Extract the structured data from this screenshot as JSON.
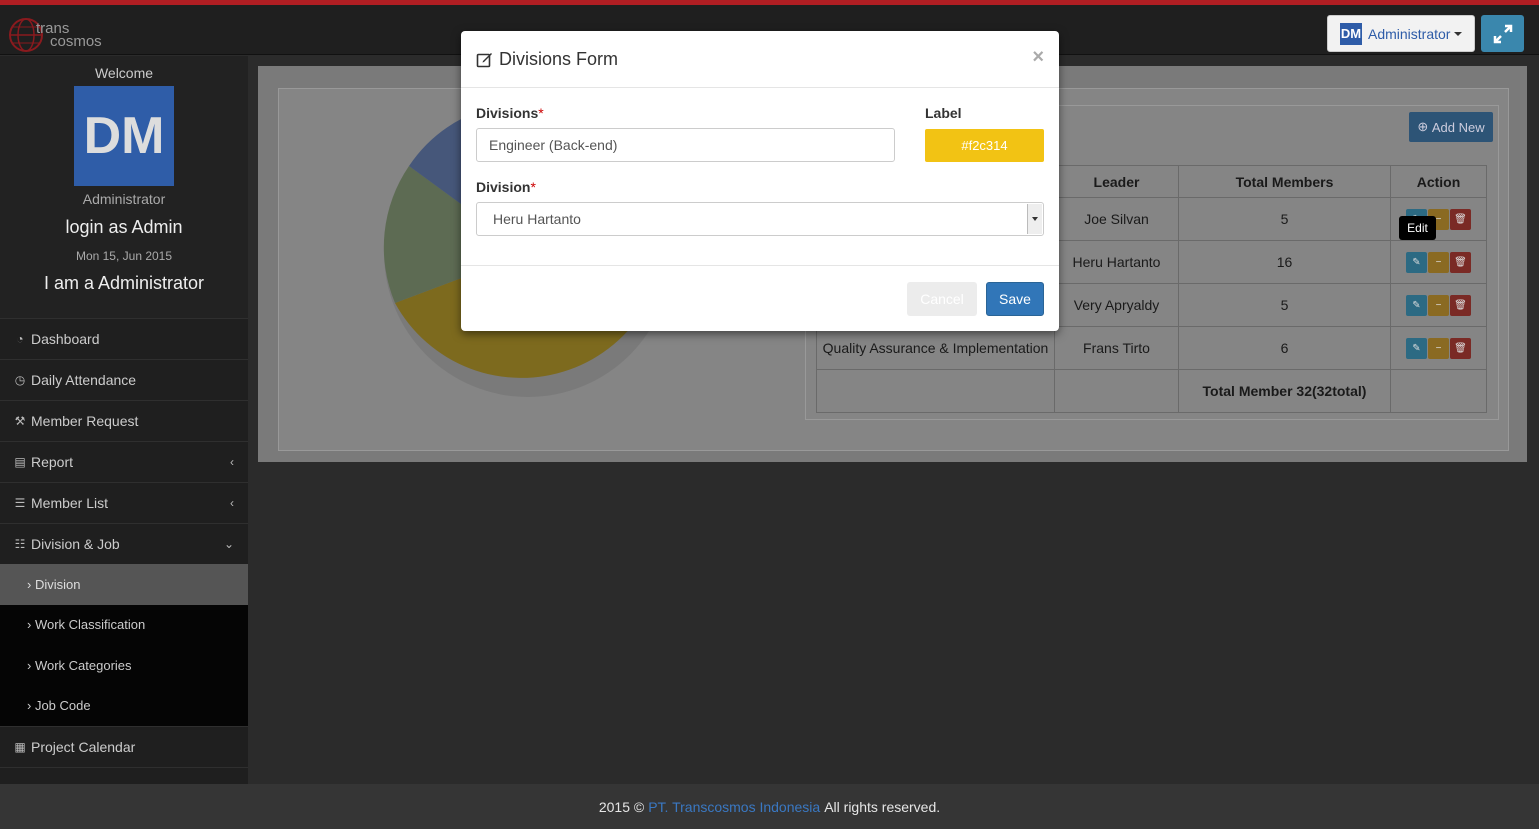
{
  "brand": {
    "logo_text_1": "trans",
    "logo_text_2": "cosmos",
    "accent": "#b01e23"
  },
  "header": {
    "user_initials": "DM",
    "user_menu_label": "Administrator"
  },
  "sidebar": {
    "welcome": "Welcome",
    "avatar_initials": "DM",
    "role": "Administrator",
    "login_as": "login as Admin",
    "date": "Mon 15, Jun 2015",
    "greeting": "I am a Administrator",
    "items": [
      {
        "label": "Dashboard",
        "icon": "dashboard-icon"
      },
      {
        "label": "Daily Attendance",
        "icon": "clock-icon"
      },
      {
        "label": "Member Request",
        "icon": "gavel-icon"
      },
      {
        "label": "Report",
        "icon": "book-icon"
      },
      {
        "label": "Member List",
        "icon": "list-icon"
      },
      {
        "label": "Division & Job",
        "icon": "tasks-icon"
      }
    ],
    "sub_items": [
      {
        "label": "Division"
      },
      {
        "label": "Work Classification"
      },
      {
        "label": "Work Categories"
      },
      {
        "label": "Job Code"
      }
    ],
    "after_items": [
      {
        "label": "Project Calendar",
        "icon": "calendar-icon"
      }
    ]
  },
  "main": {
    "add_new_label": "Add New",
    "table": {
      "headers": [
        "Leader",
        "Total Members",
        "Action"
      ],
      "rows": [
        {
          "division": "",
          "leader": "Joe Silvan",
          "total": "5"
        },
        {
          "division": "",
          "leader": "Heru Hartanto",
          "total": "16"
        },
        {
          "division": "",
          "leader": "Very Apryaldy",
          "total": "5"
        },
        {
          "division": "Quality Assurance & Implementation",
          "leader": "Frans Tirto",
          "total": "6"
        }
      ],
      "total_label": "Total Member 32(32total)"
    },
    "tooltip": "Edit",
    "pie_colors": [
      "#f2c314",
      "#7fa86a",
      "#5f85c4"
    ]
  },
  "modal": {
    "title": "Divisions Form",
    "divisions_label": "Divisions",
    "divisions_value": "Engineer (Back-end)",
    "label_label": "Label",
    "label_color": "#f2c314",
    "division_label": "Division",
    "division_value": "Heru Hartanto",
    "required_mark": "*",
    "close": "×",
    "cancel_label": "Cancel",
    "save_label": "Save"
  },
  "footer": {
    "prefix": "2015 ©",
    "company": "PT. Transcosmos Indonesia",
    "suffix": "All rights reserved."
  }
}
